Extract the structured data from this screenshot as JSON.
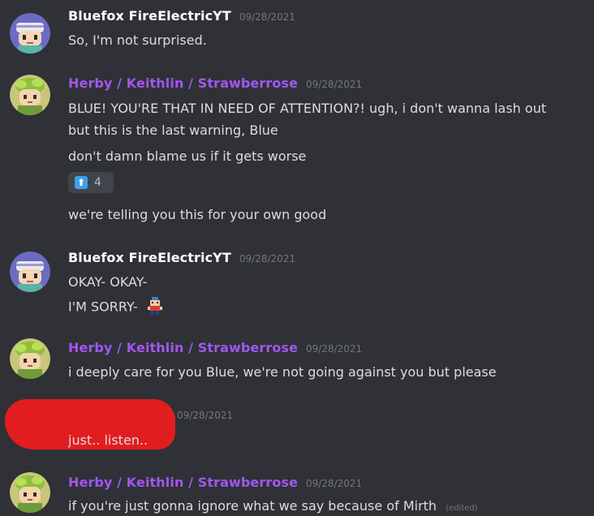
{
  "colors": {
    "background": "#2f3136",
    "text": "#dcddde",
    "timestamp": "#72767d",
    "herby_name": "#a256f0",
    "bluefox_name": "#ffffff",
    "redaction": "#e21d1f",
    "reaction_icon": "#3ca1e8"
  },
  "messages": [
    {
      "author": "Bluefox FireElectricYT",
      "timestamp": "09/28/2021",
      "avatar": "bluefox-avatar",
      "lines": [
        "So, I'm not surprised."
      ]
    },
    {
      "author": "Herby / Keithlin / Strawberrose",
      "timestamp": "09/28/2021",
      "avatar": "herby-avatar",
      "lines": [
        "BLUE! YOU'RE THAT IN NEED OF ATTENTION?! ugh, i don't wanna lash out",
        "but this is the last warning, Blue",
        "don't damn blame us if it gets worse",
        "we're telling you this for your own good"
      ],
      "reaction": {
        "icon": "up-arrow-icon",
        "count": "4"
      }
    },
    {
      "author": "Bluefox FireElectricYT",
      "timestamp": "09/28/2021",
      "avatar": "bluefox-avatar",
      "lines": [
        "OKAY- OKAY-",
        "I'M SORRY-"
      ],
      "sprite": "pixel-character-emoji"
    },
    {
      "author": "Herby / Keithlin / Strawberrose",
      "timestamp": "09/28/2021",
      "avatar": "herby-avatar",
      "lines": [
        "i deeply care for you Blue, we're not going against you but please"
      ]
    },
    {
      "author": "",
      "timestamp": "09/28/2021",
      "avatar": "redacted",
      "lines": [
        "just.. listen.."
      ]
    },
    {
      "author": "Herby / Keithlin / Strawberrose",
      "timestamp": "09/28/2021",
      "avatar": "herby-avatar",
      "lines": [
        "if you're just gonna ignore what we say because of Mirth"
      ],
      "edited_label": "(edited)"
    }
  ]
}
